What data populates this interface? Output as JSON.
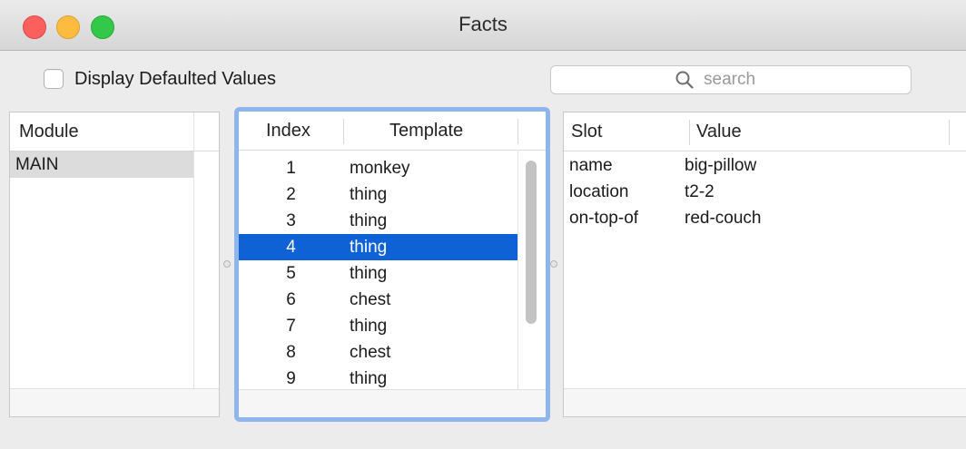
{
  "window": {
    "title": "Facts"
  },
  "toolbar": {
    "checkbox_label": "Display Defaulted Values",
    "checkbox_checked": false,
    "search_placeholder": "search",
    "search_value": ""
  },
  "module_panel": {
    "header": "Module",
    "rows": [
      "MAIN"
    ],
    "selected_index": 0
  },
  "facts_panel": {
    "headers": {
      "index": "Index",
      "template": "Template"
    },
    "rows": [
      {
        "index": "1",
        "template": "monkey"
      },
      {
        "index": "2",
        "template": "thing"
      },
      {
        "index": "3",
        "template": "thing"
      },
      {
        "index": "4",
        "template": "thing"
      },
      {
        "index": "5",
        "template": "thing"
      },
      {
        "index": "6",
        "template": "chest"
      },
      {
        "index": "7",
        "template": "thing"
      },
      {
        "index": "8",
        "template": "chest"
      },
      {
        "index": "9",
        "template": "thing"
      }
    ],
    "selected_index": 3
  },
  "slots_panel": {
    "headers": {
      "slot": "Slot",
      "value": "Value"
    },
    "rows": [
      {
        "slot": "name",
        "value": "big-pillow"
      },
      {
        "slot": "location",
        "value": "t2-2"
      },
      {
        "slot": "on-top-of",
        "value": "red-couch"
      }
    ]
  },
  "colors": {
    "selection_blue": "#0f62d6",
    "focus_ring": "#8fb6ec",
    "close": "#fc605c",
    "minimize": "#fdbc40",
    "maximize": "#34c84a"
  }
}
